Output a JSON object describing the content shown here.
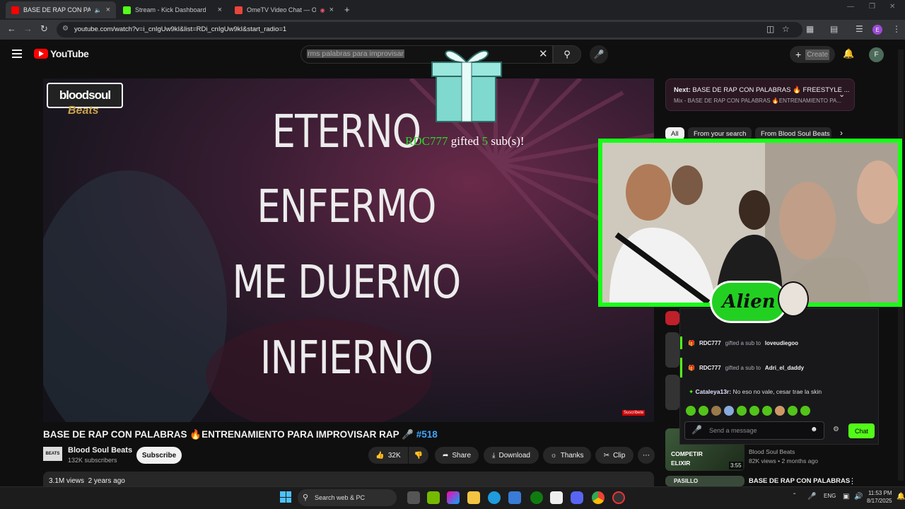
{
  "browser": {
    "tabs": [
      {
        "title": "BASE DE RAP CON PALABR",
        "active": true,
        "favicon_color": "#ff0000"
      },
      {
        "title": "Stream - Kick Dashboard",
        "active": false,
        "favicon_color": "#53fc18"
      },
      {
        "title": "OmeTV Video Chat — Ome",
        "active": false,
        "favicon_color": "#e8453c"
      }
    ],
    "url": "youtube.com/watch?v=i_cnIgUw9kI&list=RDi_cnIgUw9kI&start_radio=1",
    "profile_initial": "E"
  },
  "youtube": {
    "logo_text": "YouTube",
    "search_value": "rms palabras para improvisar",
    "create_label": "Create",
    "avatar_initial": "F"
  },
  "video": {
    "channel_logo_text": "bloodsoul",
    "channel_logo_sub": "Beats",
    "lyrics": [
      "ETERNO",
      "ENFERMO",
      "ME DUERMO",
      "INFIERNO"
    ],
    "subscribe_watermark": "Suscribete",
    "gift_user": "RDC777",
    "gift_word": "gifted",
    "gift_count": "5",
    "gift_unit": "sub(s)!",
    "title": "BASE DE RAP CON PALABRAS 🔥ENTRENAMIENTO PARA IMPROVISAR RAP 🎤",
    "hashtag": "#518",
    "channel_name": "Blood Soul Beats",
    "channel_badge": "BEATS",
    "subscribers": "132K subscribers",
    "subscribe_label": "Subscribe",
    "likes": "32K",
    "share_label": "Share",
    "download_label": "Download",
    "thanks_label": "Thanks",
    "clip_label": "Clip",
    "views": "3.1M views",
    "age": "2 years ago"
  },
  "sidebar": {
    "next_label": "Next:",
    "next_title": "BASE DE RAP CON PALABRAS 🔥 FREESTYLE ...",
    "next_sub": "Mix - BASE DE RAP CON PALABRAS 🔥ENTRENAMIENTO PA...",
    "chips": [
      "All",
      "From your search",
      "From Blood Soul Beats"
    ],
    "item1_thumb": "COMPETIR ELIXIR",
    "item1_duration": "3:55",
    "item1_channel": "Blood Soul Beats",
    "item1_meta": "82K views • 2 months ago",
    "item2_thumb": "PASILLO",
    "item2_title": "BASE DE RAP CON PALABRAS"
  },
  "overlay": {
    "alien_text": "Alien"
  },
  "chat": {
    "rows": [
      {
        "user": "RDC777",
        "text": "gifted a sub to",
        "target": "loveudiegoo"
      },
      {
        "user": "RDC777",
        "text": "gifted a sub to",
        "target": "Adri_el_daddy"
      }
    ],
    "last_user": "Cataleya13r:",
    "last_text": "No eso no vale, cesar trae la skin",
    "placeholder": "Send a message",
    "chat_button": "Chat"
  },
  "taskbar": {
    "search_label": "Search web & PC",
    "language": "ENG",
    "time": "11:53 PM",
    "date": "8/17/2025"
  }
}
